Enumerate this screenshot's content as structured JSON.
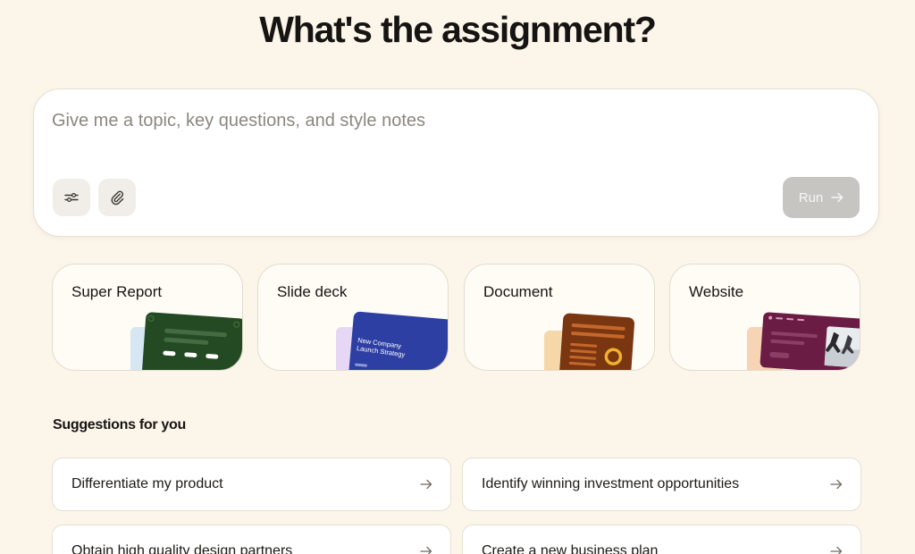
{
  "header": {
    "title": "What's the assignment?"
  },
  "prompt": {
    "placeholder": "Give me a topic, key questions, and style notes",
    "value": "",
    "run_label": "Run",
    "settings_icon": "sliders-icon",
    "attach_icon": "paperclip-icon"
  },
  "cards": [
    {
      "label": "Super Report",
      "color": "#234a22"
    },
    {
      "label": "Slide deck",
      "color": "#2d3fa3",
      "art_text": "New Company Launch Strategy"
    },
    {
      "label": "Document",
      "color": "#7a3511"
    },
    {
      "label": "Website",
      "color": "#6a1c44"
    }
  ],
  "suggestions": {
    "title": "Suggestions for you",
    "items": [
      {
        "label": "Differentiate my product"
      },
      {
        "label": "Identify winning investment opportunities"
      },
      {
        "label": "Obtain high quality design partners"
      },
      {
        "label": "Create a new business plan"
      }
    ]
  },
  "colors": {
    "background": "#fcf5ea",
    "card_bg": "#fffcf6",
    "run_button": "#c7c5c2"
  }
}
